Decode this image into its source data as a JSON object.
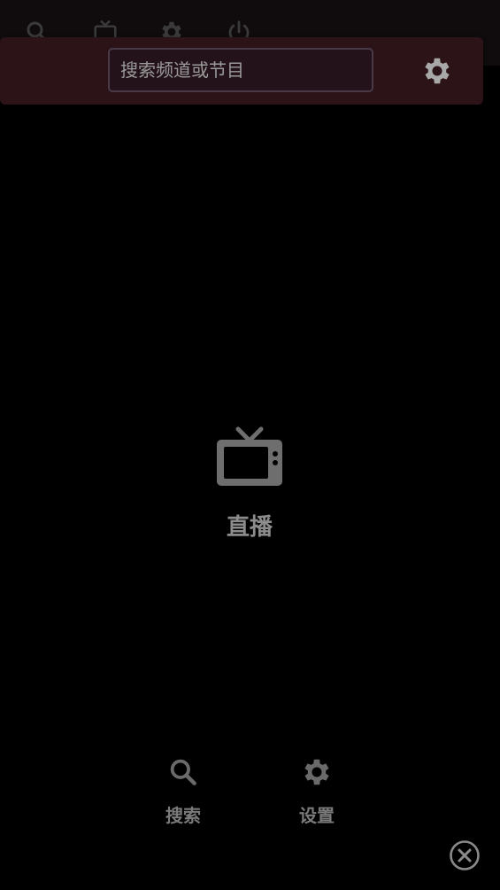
{
  "topbar": {
    "icons": [
      "search-icon",
      "tv-icon",
      "gear-icon",
      "power-icon"
    ]
  },
  "search": {
    "placeholder": "搜索频道或节目",
    "value": ""
  },
  "main": {
    "live_label": "直播",
    "live_icon": "tv-icon"
  },
  "bottom_nav": {
    "search_label": "搜索",
    "settings_label": "设置"
  },
  "colors": {
    "background": "#000000",
    "overlay": "#2c1318",
    "icon": "#8a8a8a"
  }
}
